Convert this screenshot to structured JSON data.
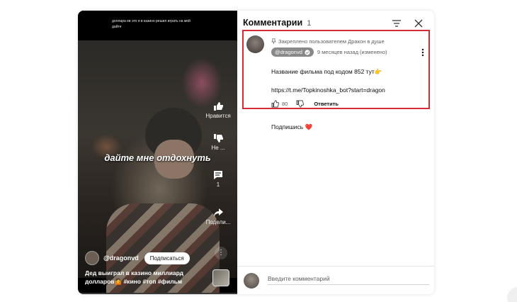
{
  "video": {
    "top_caption": "доллара ев это я в казино решил играть на мой",
    "top_caption_2": "дайте",
    "subtitle": "дайте мне отдохнуть",
    "actions": [
      {
        "icon": "thumb-up-icon",
        "label": "Нравится"
      },
      {
        "icon": "thumb-down-icon",
        "label": "Не ..."
      },
      {
        "icon": "comment-icon",
        "label": "1"
      },
      {
        "icon": "share-icon",
        "label": "Подели..."
      }
    ],
    "channel_name": "@dragonvd",
    "subscribe_label": "Подписаться",
    "description": "Дед выиграл в казино миллиард долларов🤷 #кино #топ #фильм",
    "more_icon": "more-vertical-icon"
  },
  "comments_panel": {
    "title": "Комментарии",
    "count": "1",
    "pinned": {
      "pinned_by": "Закреплено пользователем Дракон в душе",
      "author": "@dragonvd",
      "time": "9 месяцев назад (изменено)",
      "text_line1": "Название фильма под кодом 852 тут👉",
      "text_line2": "https://t.me/Topkinoshka_bot?start=dragon",
      "text_line3": "",
      "text_line4": "Подпишись ❤️",
      "likes": "80",
      "reply_label": "Ответить",
      "highlight_color": "#d62b34"
    },
    "input_placeholder": "Введите комментарий"
  }
}
